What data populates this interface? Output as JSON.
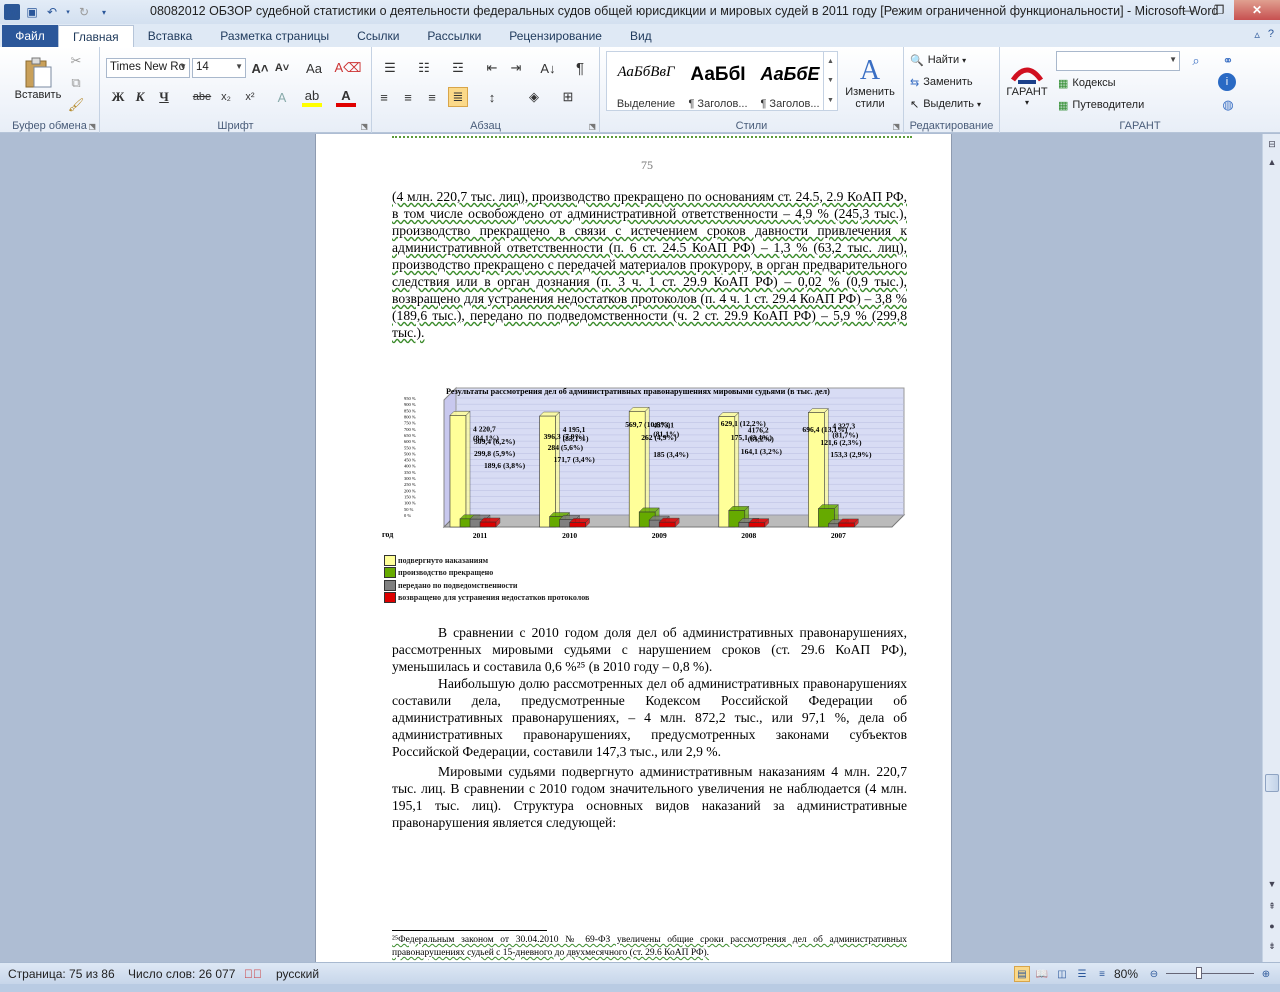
{
  "window": {
    "title": "08082012 ОБЗОР судебной статистики о деятельности федеральных судов общей юрисдикции и мировых судей в 2011 году [Режим ограниченной функциональности]  -  Microsoft Word",
    "logo": "W"
  },
  "tabs": [
    "Файл",
    "Главная",
    "Вставка",
    "Разметка страницы",
    "Ссылки",
    "Рассылки",
    "Рецензирование",
    "Вид"
  ],
  "ribbon": {
    "clipboard": {
      "label": "Буфер обмена",
      "paste": "Вставить"
    },
    "font": {
      "label": "Шрифт",
      "family": "Times New Ro",
      "size": "14",
      "bold": "Ж",
      "italic": "К",
      "underline": "Ч",
      "strike": "abe",
      "sub": "x₂",
      "sup": "x²"
    },
    "paragraph": {
      "label": "Абзац"
    },
    "styles": {
      "label": "Стили",
      "items": [
        {
          "sample": "АаБбВвГ",
          "name": "Выделение"
        },
        {
          "sample": "АаБбІ",
          "name": "¶ Заголов..."
        },
        {
          "sample": "АаБбЕ",
          "name": "¶ Заголов..."
        }
      ],
      "change": "Изменить стили"
    },
    "editing": {
      "label": "Редактирование",
      "find": "Найти",
      "replace": "Заменить",
      "select": "Выделить"
    },
    "garant": {
      "label": "ГАРАНТ",
      "button": "ГАРАНТ",
      "codes": "Кодексы",
      "guides": "Путеводители"
    }
  },
  "document": {
    "page_number": "75",
    "para1": "(4 млн. 220,7 тыс. лиц), производство прекращено по основаниям ст. 24.5, 2.9 КоАП РФ, в том числе освобождено от административной ответственности – 4,9 % (245,3 тыс.), производство прекращено в связи с истечением сроков давности привлечения к административной ответственности (п. 6 ст. 24.5 КоАП РФ) – 1,3 % (63,2 тыс. лиц), производство прекращено с передачей материалов прокурору, в орган предварительного следствия или в орган дознания (п. 3 ч. 1 ст. 29.9 КоАП РФ) – 0,02 % (0,9 тыс.), возвращено для устранения недостатков протоколов (п. 4 ч. 1 ст. 29.4 КоАП РФ) – 3,8 % (189,6 тыс.), передано по подведомственности (ч. 2 ст. 29.9 КоАП РФ) – 5,9 % (299,8 тыс.).",
    "para2": "В сравнении с 2010 годом доля дел об административных правонарушениях, рассмотренных мировыми судьями с нарушением сроков (ст. 29.6 КоАП РФ), уменьшилась и составила 0,6 %²⁵ (в  2010 году – 0,8 %).",
    "para3": "Наибольшую долю рассмотренных дел об административных правонарушениях составили дела, предусмотренные Кодексом Российской Федерации об административных правонарушениях, – 4 млн. 872,2 тыс., или 97,1 %, дела об административных правонарушениях, предусмотренных законами субъектов Российской Федерации, составили 147,3 тыс., или 2,9 %.",
    "para4": "Мировыми судьями подвергнуто административным наказаниям 4 млн. 220,7 тыс. лиц. В сравнении с 2010 годом значительного увеличения не наблюдается (4 млн. 195,1 тыс. лиц). Структура основных видов наказаний за административные правонарушения является следующей:",
    "footnote": "²⁵Федеральным законом от 30.04.2010 № 69-ФЗ увеличены общие сроки рассмотрения дел об административных правонарушениях судьей с 15-дневного до двухмесячного (ст. 29.6 КоАП РФ)."
  },
  "chart_data": {
    "type": "bar",
    "title": "Результаты рассмотрения дел об административных правонарушениях мировыми судьями (в тыс. дел)",
    "xlabel": "год",
    "ylabel": "",
    "categories": [
      "2011",
      "2010",
      "2009",
      "2008",
      "2007"
    ],
    "y_ticks": [
      "0 %",
      "50 %",
      "100 %",
      "150 %",
      "200 %",
      "250 %",
      "300 %",
      "350 %",
      "400 %",
      "450 %",
      "500 %",
      "550 %",
      "600 %",
      "650 %",
      "700 %",
      "750 %",
      "800 %",
      "850 %",
      "900 %",
      "950 %"
    ],
    "series": [
      {
        "name": "подвергнуто наказаниям",
        "color": "#ffff99",
        "values": [
          4220.7,
          4195.1,
          4373.1,
          4176.2,
          4327.3
        ],
        "labels": [
          "4 220,7\n(84,1%)",
          "4 195,1\n(83,1%)",
          "4373,1\n(81,1%)",
          "4176,2\n(81,2%)",
          "4 327,3\n(81,7%)"
        ]
      },
      {
        "name": "производство прекращено",
        "color": "#66aa00",
        "values": [
          309.4,
          396.3,
          569.7,
          629.1,
          696.4
        ],
        "labels": [
          "309,4 (6,2%)",
          "396,3 (7,9%)",
          "569,7 (10,6%)",
          "629,1 (12,2%)",
          "696,4 (13,1%)"
        ]
      },
      {
        "name": "передано по подведомственности",
        "color": "#808080",
        "values": [
          299.8,
          284,
          262,
          175.1,
          121.6
        ],
        "labels": [
          "299,8 (5,9%)",
          "284 (5,6%)",
          "262 (4,9%)",
          "175,1 (3,4%)",
          "121,6 (2,3%)"
        ]
      },
      {
        "name": "возвращено для устранения недостатков протоколов",
        "color": "#dd0000",
        "values": [
          189.6,
          171.7,
          185,
          164.1,
          153.3
        ],
        "labels": [
          "189,6 (3,8%)",
          "171,7 (3,4%)",
          "185 (3,4%)",
          "164,1 (3,2%)",
          "153,3 (2,9%)"
        ]
      }
    ]
  },
  "status": {
    "page": "Страница: 75 из 86",
    "words": "Число слов: 26 077",
    "lang": "русский",
    "zoom": "80%"
  }
}
